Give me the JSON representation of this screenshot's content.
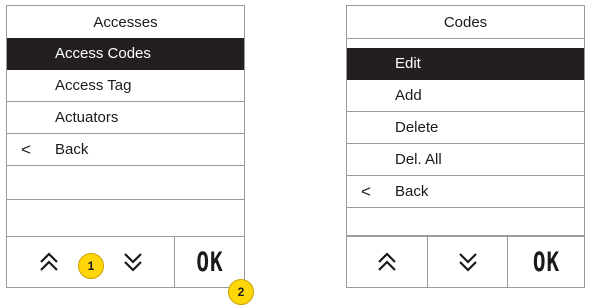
{
  "left_screen": {
    "title": "Accesses",
    "items": [
      {
        "label": "Access Codes",
        "selected": true,
        "chevron": ""
      },
      {
        "label": "Access Tag",
        "selected": false,
        "chevron": ""
      },
      {
        "label": "Actuators",
        "selected": false,
        "chevron": ""
      },
      {
        "label": "Back",
        "selected": false,
        "chevron": "<"
      }
    ],
    "footer": {
      "up_icon": "double-chevron-up-icon",
      "down_icon": "double-chevron-down-icon",
      "ok_label": "OK"
    }
  },
  "right_screen": {
    "title": "Codes",
    "items": [
      {
        "label": "Edit",
        "selected": true,
        "chevron": ""
      },
      {
        "label": "Add",
        "selected": false,
        "chevron": ""
      },
      {
        "label": "Delete",
        "selected": false,
        "chevron": ""
      },
      {
        "label": "Del. All",
        "selected": false,
        "chevron": ""
      },
      {
        "label": "Back",
        "selected": false,
        "chevron": "<"
      }
    ],
    "footer": {
      "up_icon": "double-chevron-up-icon",
      "down_icon": "double-chevron-down-icon",
      "ok_label": "OK"
    }
  },
  "callouts": [
    "1",
    "2"
  ],
  "colors": {
    "selected_bg": "#231f20",
    "callout": "#ffd60a",
    "border": "#9a9a9a"
  }
}
